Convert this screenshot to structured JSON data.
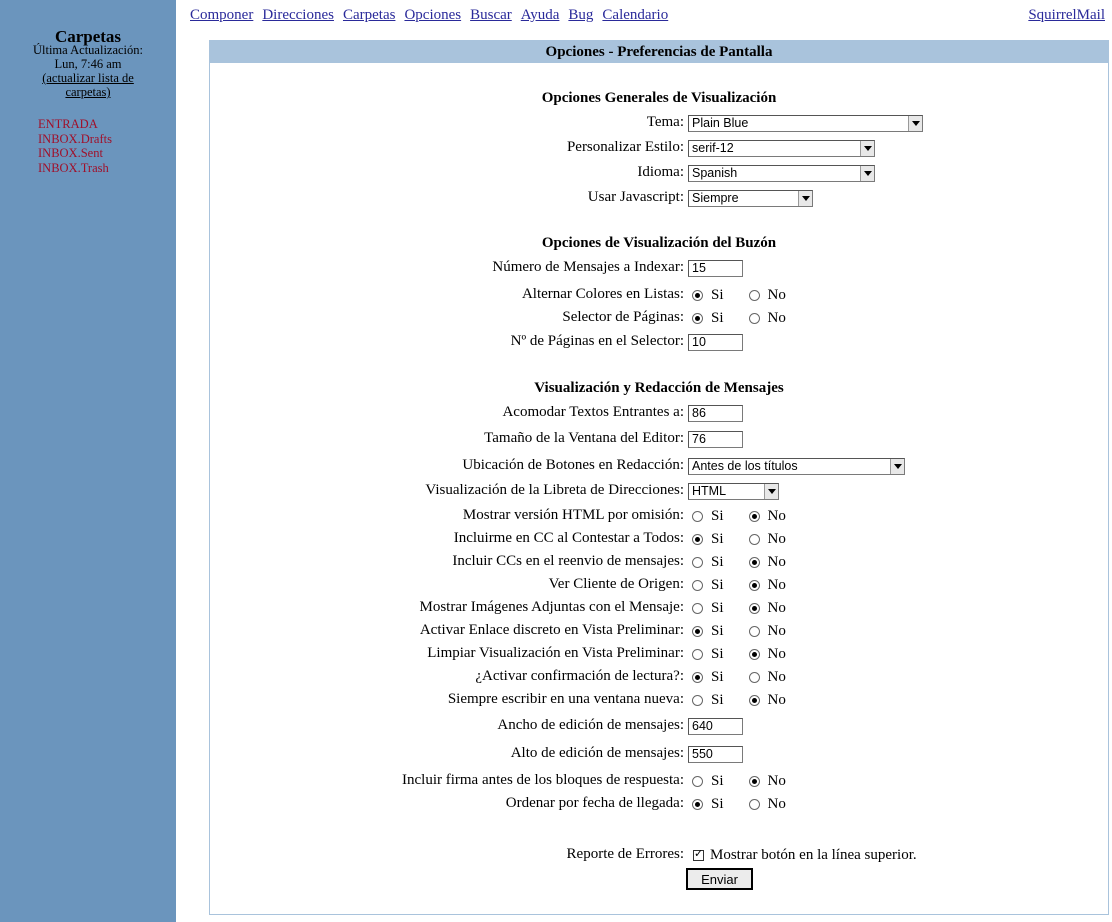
{
  "sidebar": {
    "title": "Carpetas",
    "last_update_label": "Última Actualización:",
    "last_update_time": "Lun, 7:46 am",
    "refresh_link": "(actualizar lista de carpetas)",
    "folders": [
      "ENTRADA",
      "INBOX.Drafts",
      "INBOX.Sent",
      "INBOX.Trash"
    ]
  },
  "topnav": {
    "links": [
      "Componer",
      "Direcciones",
      "Carpetas",
      "Opciones",
      "Buscar",
      "Ayuda",
      "Bug",
      "Calendario"
    ],
    "brand": "SquirrelMail"
  },
  "panel": {
    "title": "Opciones - Preferencias de Pantalla"
  },
  "sections": {
    "general": "Opciones Generales de Visualización",
    "mailbox": "Opciones de Visualización del Buzón",
    "message": "Visualización y Redacción de Mensajes"
  },
  "labels": {
    "yes": "Si",
    "no": "No"
  },
  "fields": {
    "tema": {
      "label": "Tema:",
      "value": "Plain Blue"
    },
    "estilo": {
      "label": "Personalizar Estilo:",
      "value": "serif-12"
    },
    "idioma": {
      "label": "Idioma:",
      "value": "Spanish"
    },
    "javascript": {
      "label": "Usar Javascript:",
      "value": "Siempre"
    },
    "num_mensajes": {
      "label": "Número de Mensajes a Indexar:",
      "value": "15"
    },
    "alternar_colores": {
      "label": "Alternar Colores en Listas:",
      "selected": "Si"
    },
    "selector_paginas": {
      "label": "Selector de Páginas:",
      "selected": "Si"
    },
    "num_paginas": {
      "label": "Nº de Páginas en el Selector:",
      "value": "10"
    },
    "acomodar": {
      "label": "Acomodar Textos Entrantes a:",
      "value": "86"
    },
    "tam_editor": {
      "label": "Tamaño de la Ventana del Editor:",
      "value": "76"
    },
    "ubicacion_botones": {
      "label": "Ubicación de Botones en Redacción:",
      "value": "Antes de los títulos"
    },
    "libreta": {
      "label": "Visualización de la Libreta de Direcciones:",
      "value": "HTML"
    },
    "html_omision": {
      "label": "Mostrar versión HTML por omisión:",
      "selected": "No"
    },
    "incluirme_cc": {
      "label": "Incluirme en CC al Contestar a Todos:",
      "selected": "Si"
    },
    "incluir_ccs": {
      "label": "Incluir CCs en el reenvio de mensajes:",
      "selected": "No"
    },
    "cliente_origen": {
      "label": "Ver Cliente de Origen:",
      "selected": "No"
    },
    "imagenes_adjuntas": {
      "label": "Mostrar Imágenes Adjuntas con el Mensaje:",
      "selected": "No"
    },
    "enlace_discreto": {
      "label": "Activar Enlace discreto en Vista Preliminar:",
      "selected": "Si"
    },
    "limpiar_vista": {
      "label": "Limpiar Visualización en Vista Preliminar:",
      "selected": "No"
    },
    "confirmacion_lectura": {
      "label": "¿Activar confirmación de lectura?:",
      "selected": "Si"
    },
    "ventana_nueva": {
      "label": "Siempre escribir en una ventana nueva:",
      "selected": "No"
    },
    "ancho_edicion": {
      "label": "Ancho de edición de mensajes:",
      "value": "640"
    },
    "alto_edicion": {
      "label": "Alto de edición de mensajes:",
      "value": "550"
    },
    "firma_antes": {
      "label": "Incluir firma antes de los bloques de respuesta:",
      "selected": "No"
    },
    "ordenar_fecha": {
      "label": "Ordenar por fecha de llegada:",
      "selected": "Si"
    },
    "reporte_errores": {
      "label": "Reporte de Errores:",
      "checkbox_label": "Mostrar botón en la línea superior.",
      "checked": true
    }
  },
  "submit_label": "Enviar"
}
